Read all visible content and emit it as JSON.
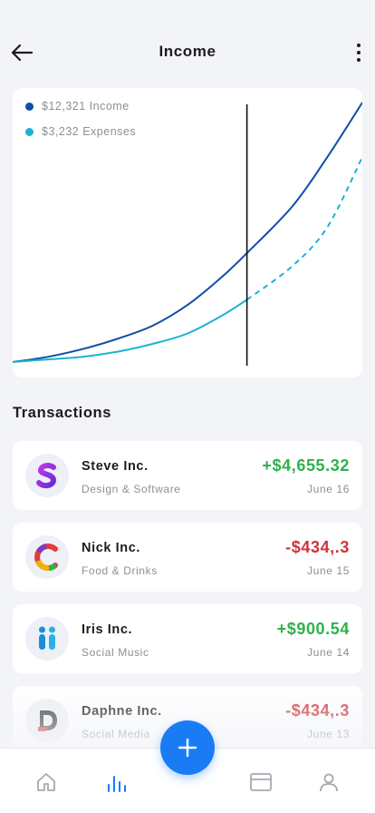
{
  "header": {
    "title": "Income",
    "back_icon": "arrow-left-icon",
    "more_icon": "more-vertical-icon"
  },
  "chart_data": {
    "type": "line",
    "legend_position": "top-left",
    "grid": false,
    "marker_fraction": 0.67,
    "series": [
      {
        "name": "$12,321 Income",
        "color": "#0d4ea6",
        "style": "solid",
        "points": [
          [
            0,
            0.0
          ],
          [
            0.1,
            0.02
          ],
          [
            0.2,
            0.05
          ],
          [
            0.3,
            0.09
          ],
          [
            0.4,
            0.14
          ],
          [
            0.5,
            0.22
          ],
          [
            0.6,
            0.33
          ],
          [
            0.67,
            0.42
          ],
          [
            0.8,
            0.6
          ],
          [
            0.9,
            0.79
          ],
          [
            1.0,
            1.0
          ]
        ]
      },
      {
        "name": "$3,232 Expenses",
        "color": "#1ab3d4",
        "style": "solid-then-dashed",
        "points": [
          [
            0,
            0.0
          ],
          [
            0.1,
            0.01
          ],
          [
            0.2,
            0.02
          ],
          [
            0.3,
            0.04
          ],
          [
            0.4,
            0.07
          ],
          [
            0.5,
            0.11
          ],
          [
            0.6,
            0.18
          ],
          [
            0.67,
            0.24
          ],
          [
            0.8,
            0.37
          ],
          [
            0.9,
            0.52
          ],
          [
            1.0,
            0.79
          ]
        ]
      }
    ]
  },
  "legend": [
    {
      "label": "$12,321 Income",
      "color": "#0d4ea6"
    },
    {
      "label": "$3,232 Expenses",
      "color": "#1ab3d4"
    }
  ],
  "transactions_title": "Transactions",
  "transactions": [
    {
      "name": "Steve Inc.",
      "category": "Design & Software",
      "amount": "+$4,655.32",
      "sign": "pos",
      "date": "June 16",
      "logo_icon": "s-letter-logo-icon"
    },
    {
      "name": "Nick Inc.",
      "category": "Food & Drinks",
      "amount": "-$434,.3",
      "sign": "neg",
      "date": "June 15",
      "logo_icon": "c-letter-logo-icon"
    },
    {
      "name": "Iris Inc.",
      "category": "Social Music",
      "amount": "+$900.54",
      "sign": "pos",
      "date": "June 14",
      "logo_icon": "ii-letters-logo-icon"
    },
    {
      "name": "Daphne Inc.",
      "category": "Social Media",
      "amount": "-$434,.3",
      "sign": "neg",
      "date": "June 13",
      "logo_icon": "d-letter-logo-icon"
    }
  ],
  "bottom_nav": {
    "items": [
      {
        "icon": "home-icon",
        "active": false
      },
      {
        "icon": "chart-bars-icon",
        "active": true
      },
      {
        "icon": "card-icon",
        "active": false
      },
      {
        "icon": "profile-icon",
        "active": false
      }
    ],
    "fab_icon": "plus-icon",
    "accent": "#1a7cf5"
  }
}
